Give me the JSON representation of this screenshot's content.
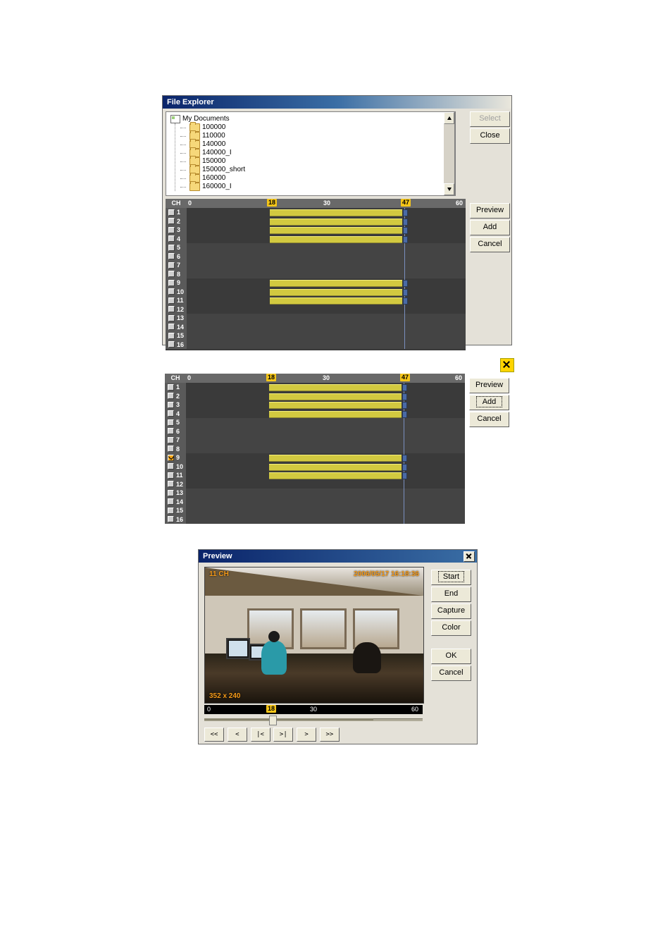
{
  "panel1": {
    "title": "File Explorer",
    "tree_root": "My Documents",
    "folders": [
      "100000",
      "110000",
      "140000",
      "140000_I",
      "150000",
      "150000_short",
      "160000",
      "160000_I"
    ],
    "select_label": "Select",
    "close_label": "Close"
  },
  "timeline1": {
    "ch_header": "CH",
    "ticks": {
      "t0": "0",
      "t30": "30",
      "t60": "60"
    },
    "flag_start": "18",
    "flag_end": "47",
    "preview_label": "Preview",
    "add_label": "Add",
    "cancel_label": "Cancel",
    "rows": [
      "1",
      "2",
      "3",
      "4",
      "5",
      "6",
      "7",
      "8",
      "9",
      "10",
      "11",
      "12",
      "13",
      "14",
      "15",
      "16"
    ]
  },
  "timeline2": {
    "ch_header": "CH",
    "ticks": {
      "t0": "0",
      "t30": "30",
      "t60": "60"
    },
    "flag_start": "18",
    "flag_end": "47",
    "preview_label": "Preview",
    "add_label": "Add",
    "cancel_label": "Cancel",
    "rows": [
      "1",
      "2",
      "3",
      "4",
      "5",
      "6",
      "7",
      "8",
      "9",
      "10",
      "11",
      "12",
      "13",
      "14",
      "15",
      "16"
    ]
  },
  "preview": {
    "title": "Preview",
    "overlay_ch": "11 CH",
    "overlay_ts": "2006/05/17 16:18:36",
    "overlay_res": "352 x 240",
    "start_label": "Start",
    "end_label": "End",
    "capture_label": "Capture",
    "color_label": "Color",
    "ok_label": "OK",
    "cancel_label": "Cancel",
    "ticks": {
      "t0": "0",
      "t30": "30",
      "t60": "60"
    },
    "flag": "18",
    "nav": [
      "<<",
      "<",
      "|<",
      ">|",
      ">",
      ">>"
    ]
  }
}
